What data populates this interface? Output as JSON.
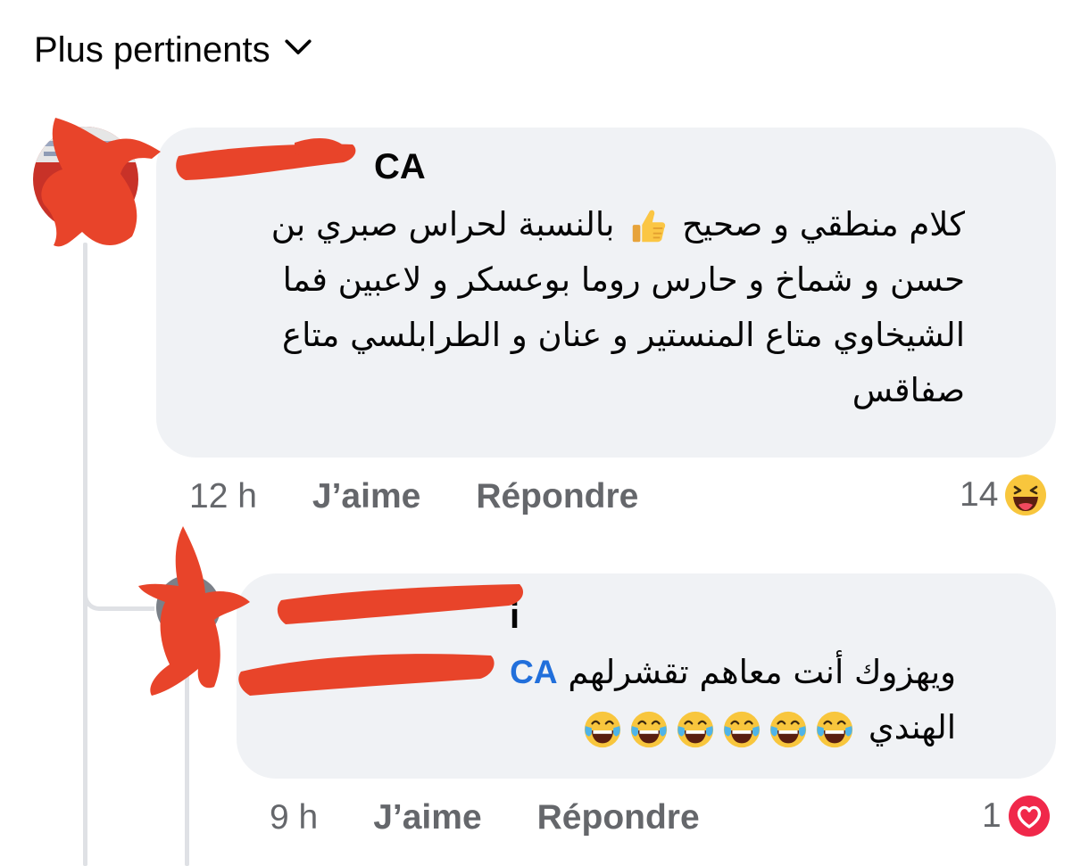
{
  "sort": {
    "label": "Plus pertinents",
    "icon": "chevron-down-icon"
  },
  "comments": [
    {
      "author_visible_suffix": "CA",
      "body": "كلام منطقي و صحيح 👍 بالنسبة لحراس صبري بن حسن و شماخ و حارس روما بوعسكر و لاعبين فما الشيخاوي متاع المنستير و عنان و الطرابلسي متاع صفاقس",
      "body_before_emoji": "كلام منطقي و صحيح",
      "emoji": "thumbs-up-icon",
      "body_after_emoji": "بالنسبة لحراس صبري بن حسن و شماخ و حارس روما بوعسكر و لاعبين فما الشيخاوي متاع المنستير و عنان و الطرابلسي متاع صفاقس",
      "time": "12 h",
      "like_label": "J’aime",
      "reply_label": "Répondre",
      "reaction_count": "14",
      "reaction_icon": "haha-icon"
    },
    {
      "author_visible_suffix": "i",
      "mention_visible_suffix": "CA",
      "body_text": "ويهزوك أنت معاهم تقشرلهم",
      "body_line2": "الهندي",
      "emoji": "tears-of-joy-icon",
      "emoji_count": 6,
      "time": "9 h",
      "like_label": "J’aime",
      "reply_label": "Répondre",
      "reaction_count": "1",
      "reaction_icon": "love-icon"
    }
  ],
  "colors": {
    "bubble": "#f0f2f5",
    "meta_text": "#65676b",
    "mention": "#216fdb",
    "scribble": "#e8442a",
    "thread_line": "#dfe1e5"
  }
}
